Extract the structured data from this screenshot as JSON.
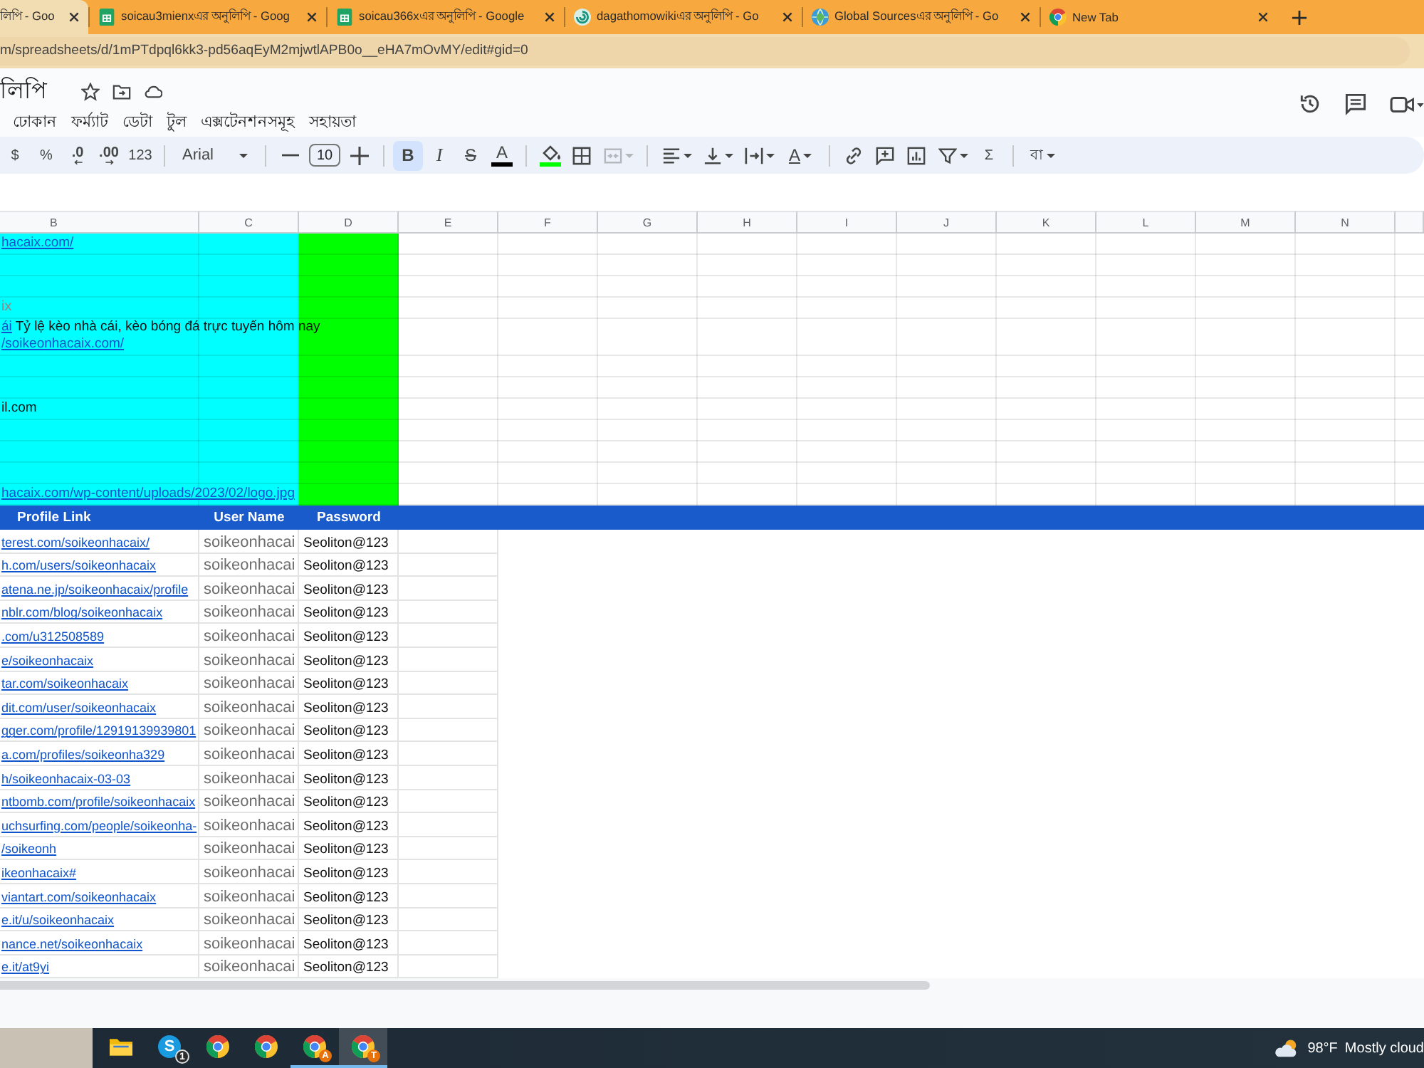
{
  "browser": {
    "tabs": [
      {
        "title": "লিপি - Goo",
        "selected": true
      },
      {
        "title": "soicau3mienxএর অনুলিপি - Goog",
        "kind": "sheets",
        "selected": false
      },
      {
        "title": "soicau366xএর অনুলিপি - Google",
        "kind": "sheets",
        "selected": false
      },
      {
        "title": "dagathomowikiএর অনুলিপি - Go",
        "kind": "swirl",
        "selected": false
      },
      {
        "title": "Global Sourcesএর অনুলিপি - Go",
        "kind": "globe",
        "selected": false
      },
      {
        "title": "New Tab",
        "kind": "browser",
        "selected": false
      }
    ],
    "address": "m/spreadsheets/d/1mPTdpql6kk3-pd56aqEyM2mjwtlAPB0o__eHA7mOvMY/edit#gid=0"
  },
  "doc": {
    "title": "লিপি",
    "menu": [
      "ঢোকান",
      "ফর্ম্যাট",
      "ডেটা",
      "টুল",
      "এক্সটেনশনসমূহ",
      "সহায়তা"
    ]
  },
  "toolbar": [
    {
      "kind": "text",
      "label": "$",
      "dropdown": false
    },
    {
      "kind": "text",
      "label": "%",
      "dropdown": false
    },
    {
      "kind": "decrease",
      "label": ".0"
    },
    {
      "kind": "increase",
      "label": ".00"
    },
    {
      "kind": "text",
      "label": "123",
      "dropdown": false
    },
    {
      "kind": "separator"
    },
    {
      "kind": "font",
      "label": "Arial"
    },
    {
      "kind": "separator"
    },
    {
      "kind": "size",
      "value": "10"
    },
    {
      "kind": "separator"
    },
    {
      "kind": "bold",
      "label": "B",
      "on": true
    },
    {
      "kind": "italic",
      "label": "I",
      "on": false
    },
    {
      "kind": "strike",
      "label": "S",
      "on": false
    },
    {
      "kind": "color",
      "label": "A",
      "color": "#000000"
    },
    {
      "kind": "separator"
    },
    {
      "kind": "fill",
      "color": "#00ff00"
    },
    {
      "kind": "borders",
      "dropdown": false,
      "disabled": false
    },
    {
      "kind": "merge",
      "dropdown": true,
      "disabled": true
    },
    {
      "kind": "separator"
    },
    {
      "kind": "align",
      "dropdown": true,
      "disabled": false
    },
    {
      "kind": "valign",
      "dropdown": true,
      "disabled": false
    },
    {
      "kind": "wrap",
      "dropdown": true,
      "disabled": false
    },
    {
      "kind": "rotate",
      "label": "A",
      "dropdown": true
    },
    {
      "kind": "separator"
    },
    {
      "kind": "link",
      "dropdown": false,
      "disabled": false
    },
    {
      "kind": "comment",
      "dropdown": false,
      "disabled": false
    },
    {
      "kind": "chart",
      "dropdown": false,
      "disabled": false
    },
    {
      "kind": "filter",
      "dropdown": true,
      "disabled": false
    },
    {
      "kind": "text",
      "label": "Σ",
      "dropdown": false
    },
    {
      "kind": "separator"
    },
    {
      "kind": "text",
      "label": "বা",
      "dropdown": true
    }
  ],
  "sheet": {
    "columns": [
      "B",
      "C",
      "D",
      "E",
      "F",
      "G",
      "H",
      "I",
      "J",
      "K",
      "L",
      "M",
      "N"
    ],
    "fills": [
      {
        "color": "#00ffff"
      },
      {
        "color": "#00ffff"
      },
      {
        "color": "#00ff00"
      }
    ],
    "info_rows": [
      {
        "lines": [
          [
            {
              "kind": "link",
              "text": "hacaix.com/"
            }
          ]
        ]
      },
      {},
      {},
      {
        "lines": [
          [
            {
              "kind": "muted",
              "text": "ix"
            }
          ]
        ]
      },
      {
        "lines": [
          [
            {
              "kind": "link",
              "text": "ái"
            },
            {
              "kind": "plain",
              "text": "Tỷ lệ kèo nhà cái, kèo bóng đá trực tuyến hôm nay"
            }
          ],
          [
            {
              "kind": "link",
              "text": "/soikeonhacaix.com/"
            }
          ]
        ]
      },
      {},
      {},
      {
        "lines": [
          [
            {
              "kind": "plain",
              "text": "il.com"
            }
          ]
        ]
      },
      {},
      {},
      {},
      {
        "lines": [
          [
            {
              "kind": "link",
              "text": "hacaix.com/wp-content/uploads/2023/02/logo.jpg"
            }
          ]
        ]
      }
    ],
    "table": {
      "header": [
        "Profile Link",
        "User Name",
        "Password"
      ],
      "rows": [
        {
          "link": "terest.com/soikeonhacaix/",
          "user": "soikeonhacai",
          "password": "Seoliton@123"
        },
        {
          "link": "h.com/users/soikeonhacaix",
          "user": "soikeonhacai",
          "password": "Seoliton@123"
        },
        {
          "link": "atena.ne.jp/soikeonhacaix/profile",
          "user": "soikeonhacai",
          "password": "Seoliton@123"
        },
        {
          "link": "nblr.com/blog/soikeonhacaix",
          "user": "soikeonhacai",
          "password": "Seoliton@123"
        },
        {
          "link": ".com/u312508589",
          "user": "soikeonhacai",
          "password": "Seoliton@123"
        },
        {
          "link": "e/soikeonhacaix",
          "user": "soikeonhacai",
          "password": "Seoliton@123"
        },
        {
          "link": "tar.com/soikeonhacaix",
          "user": "soikeonhacai",
          "password": "Seoliton@123"
        },
        {
          "link": "dit.com/user/soikeonhacaix",
          "user": "soikeonhacai",
          "password": "Seoliton@123"
        },
        {
          "link": "gger.com/profile/12919139939801",
          "user": "soikeonhacai",
          "password": "Seoliton@123"
        },
        {
          "link": "a.com/profiles/soikeonha329",
          "user": "soikeonhacai",
          "password": "Seoliton@123"
        },
        {
          "link": "h/soikeonhacaix-03-03",
          "user": "soikeonhacai",
          "password": "Seoliton@123"
        },
        {
          "link": "ntbomb.com/profile/soikeonhacaix",
          "user": "soikeonhacai",
          "password": "Seoliton@123"
        },
        {
          "link": "uchsurfing.com/people/soikeonha-",
          "user": "soikeonhacai",
          "password": "Seoliton@123"
        },
        {
          "link": "/soikeonh",
          "user": "soikeonhacai",
          "password": "Seoliton@123"
        },
        {
          "link": "ikeonhacaix#",
          "user": "soikeonhacai",
          "password": "Seoliton@123"
        },
        {
          "link": "viantart.com/soikeonhacaix",
          "user": "soikeonhacai",
          "password": "Seoliton@123"
        },
        {
          "link": "e.it/u/soikeonhacaix",
          "user": "soikeonhacai",
          "password": "Seoliton@123"
        },
        {
          "link": "nance.net/soikeonhacaix",
          "user": "soikeonhacai",
          "password": "Seoliton@123"
        },
        {
          "link": "e.it/at9yi",
          "user": "soikeonhacai",
          "password": "Seoliton@123"
        }
      ]
    }
  },
  "taskbar": {
    "apps": [
      {
        "kind": "folder",
        "selected": false,
        "running": false
      },
      {
        "kind": "chat",
        "glyph": "S",
        "badge": "1",
        "selected": false,
        "running": false
      },
      {
        "kind": "browser",
        "selected": false,
        "running": false
      },
      {
        "kind": "browser",
        "selected": false,
        "running": false
      },
      {
        "kind": "browser",
        "profile": "A",
        "selected": false,
        "running": true
      },
      {
        "kind": "browser",
        "profile": "T",
        "selected": true,
        "running": true
      }
    ],
    "weather": {
      "temperature": "98°F",
      "condition": "Mostly cloud"
    }
  }
}
